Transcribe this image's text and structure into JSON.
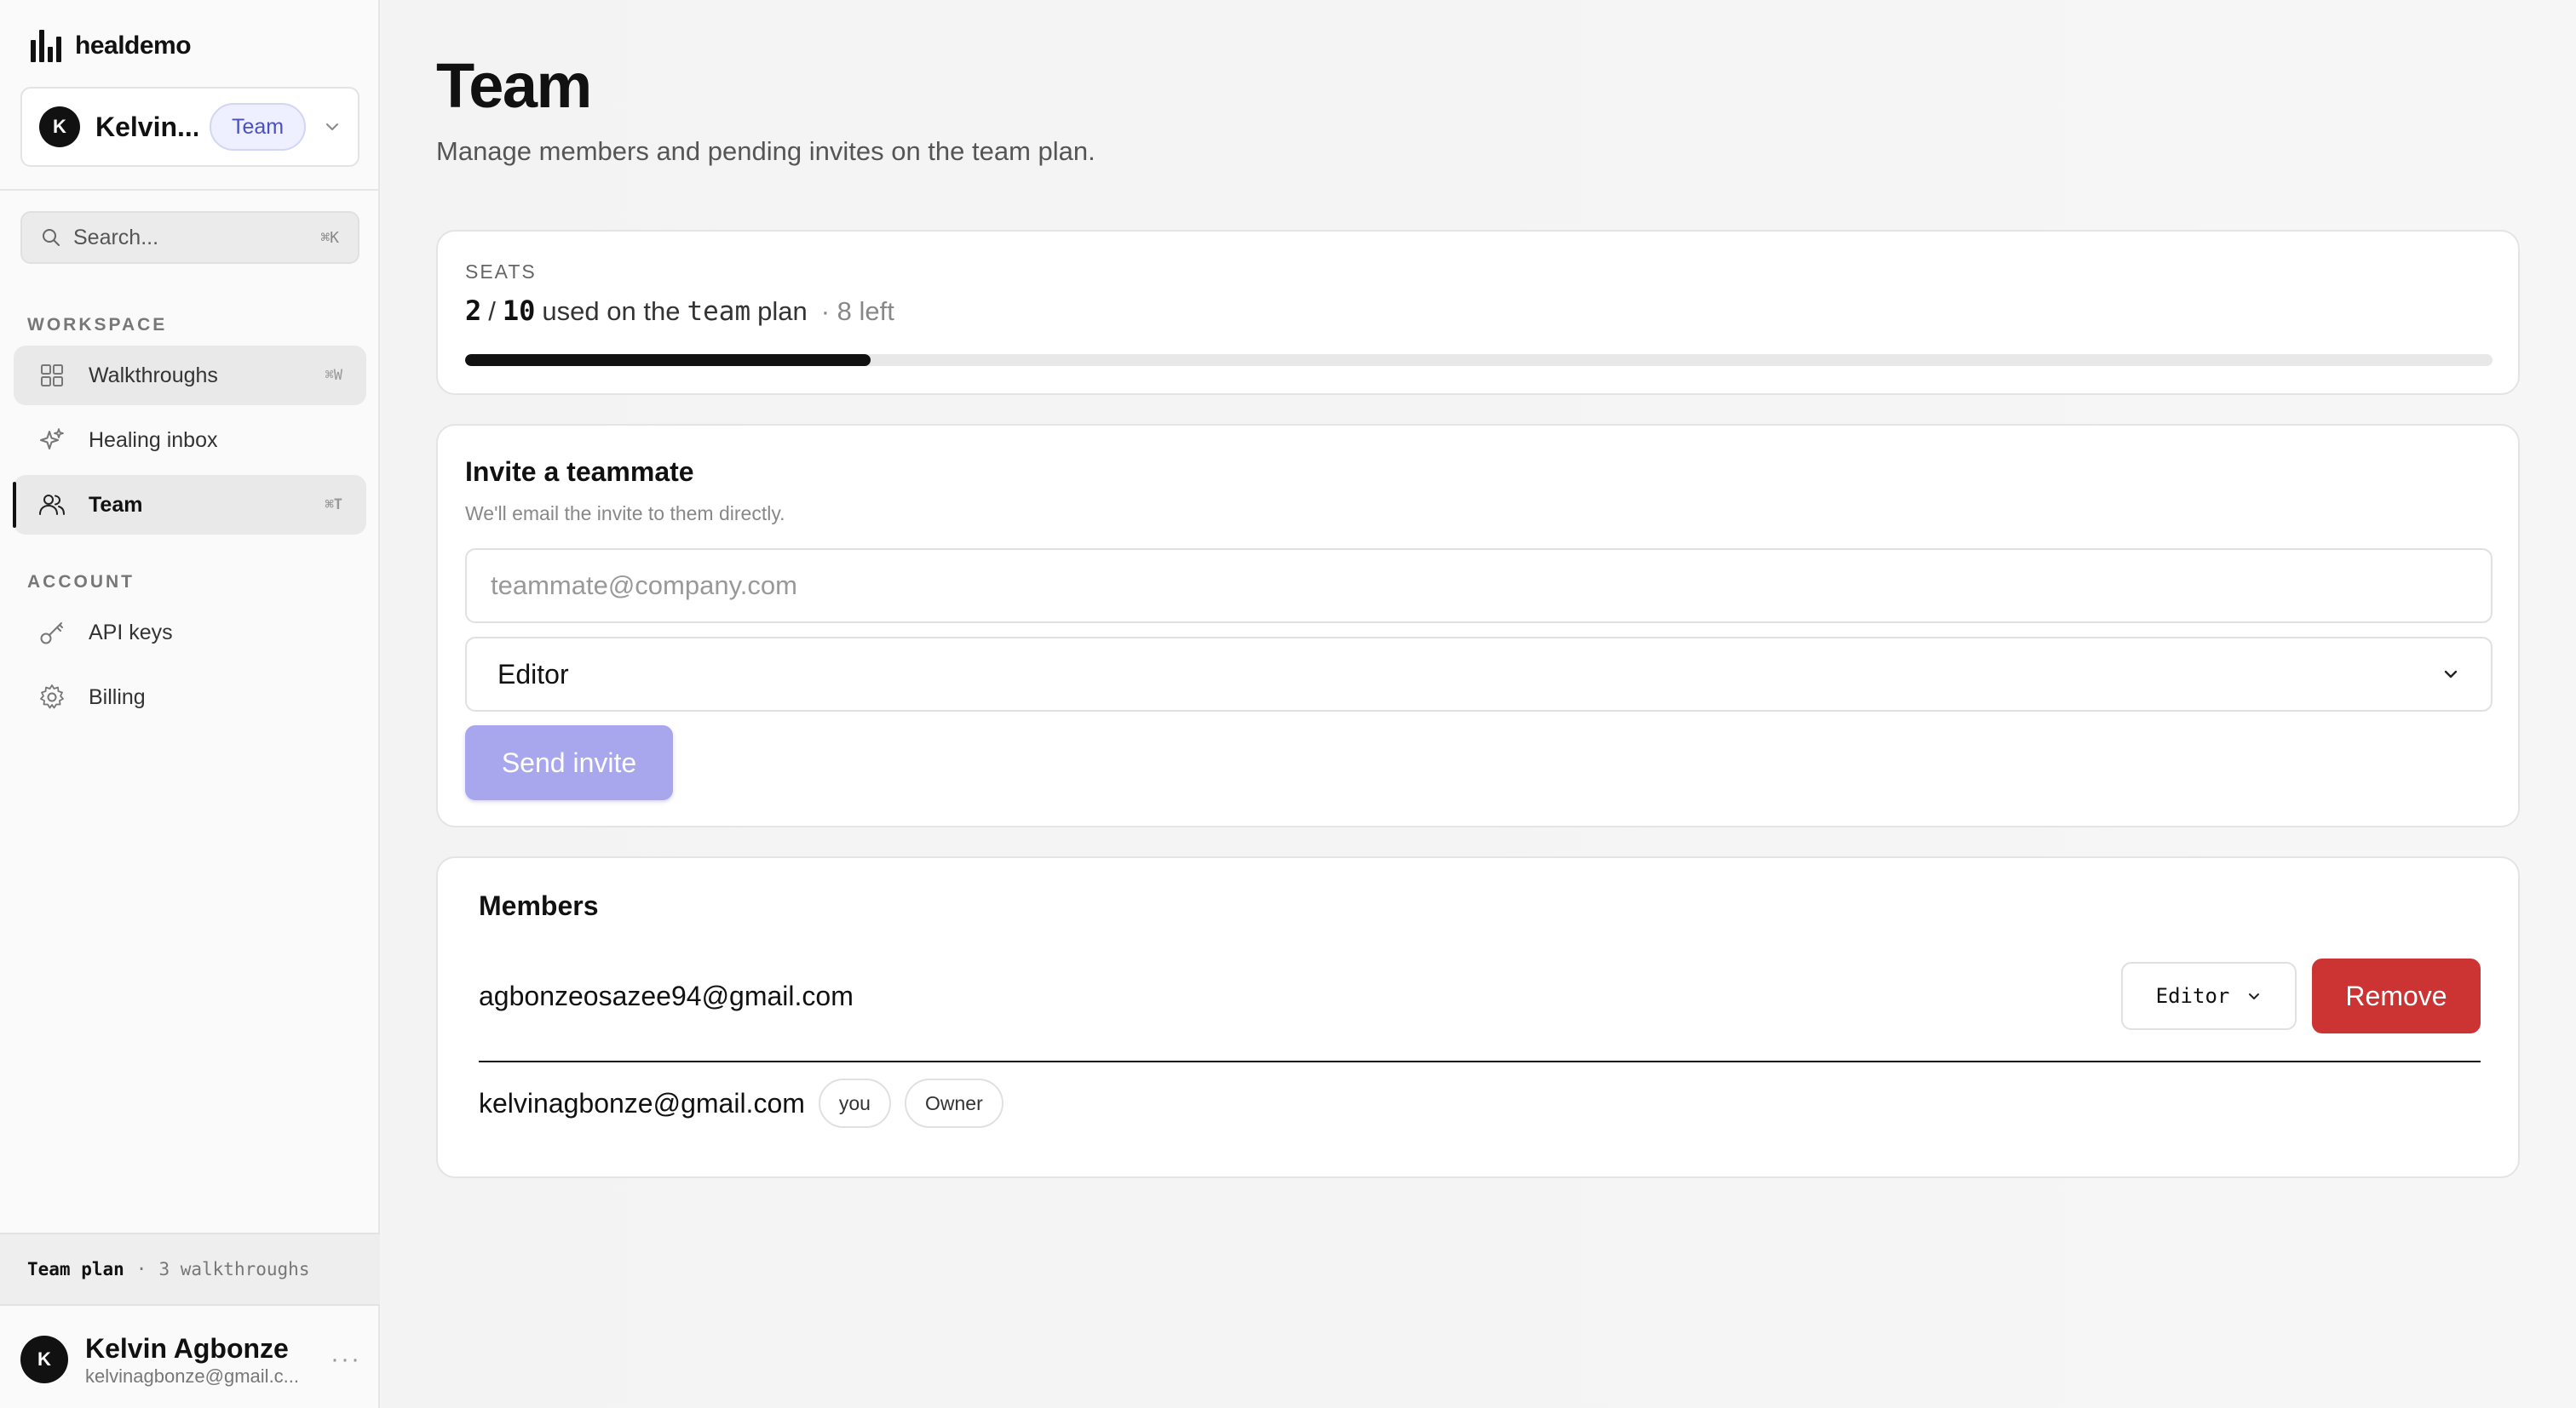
{
  "brand": {
    "name": "healdemo"
  },
  "workspace": {
    "avatar_initial": "K",
    "name": "Kelvin...",
    "plan_badge": "Team"
  },
  "search": {
    "placeholder": "Search...",
    "shortcut": "⌘K"
  },
  "sidebar": {
    "workspace_label": "WORKSPACE",
    "account_label": "ACCOUNT",
    "workspace_items": [
      {
        "label": "Walkthroughs",
        "shortcut": "⌘W",
        "icon": "grid-icon"
      },
      {
        "label": "Healing inbox",
        "shortcut": "",
        "icon": "sparkle-icon"
      },
      {
        "label": "Team",
        "shortcut": "⌘T",
        "icon": "users-icon",
        "active": true
      }
    ],
    "account_items": [
      {
        "label": "API keys",
        "icon": "key-icon"
      },
      {
        "label": "Billing",
        "icon": "gear-icon"
      }
    ]
  },
  "plan_bar": {
    "plan": "Team plan",
    "separator": "·",
    "detail": "3 walkthroughs"
  },
  "user": {
    "avatar_initial": "K",
    "name": "Kelvin Agbonze",
    "email": "kelvinagbonze@gmail.c...",
    "more": "···"
  },
  "page": {
    "title": "Team",
    "subtitle": "Manage members and pending invites on the team plan."
  },
  "seats": {
    "label": "SEATS",
    "used": "2",
    "slash": "/",
    "total": "10",
    "text_before": "used on the",
    "plan_code": "team",
    "text_after": "plan",
    "left": "· 8 left",
    "fill_fraction": 0.2
  },
  "invite": {
    "title": "Invite a teammate",
    "description": "We'll email the invite to them directly.",
    "email_placeholder": "teammate@company.com",
    "role_value": "Editor",
    "send_label": "Send invite"
  },
  "members": {
    "title": "Members",
    "rows": [
      {
        "email": "agbonzeosazee94@gmail.com",
        "role": "Editor",
        "action": "Remove"
      },
      {
        "email": "kelvinagbonze@gmail.com",
        "you_tag": "you",
        "role_tag": "Owner"
      }
    ]
  },
  "colors": {
    "accent_disabled": "#a8a7ee",
    "danger": "#cc3333",
    "plan_badge": "#4b50c0"
  }
}
